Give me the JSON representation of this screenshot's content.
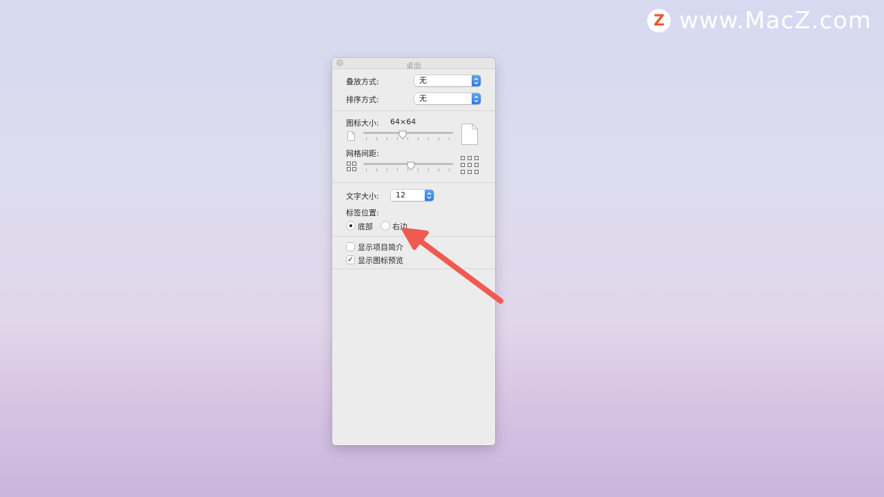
{
  "watermark": {
    "logo_letter": "Z",
    "text": "www.MacZ.com"
  },
  "window": {
    "title": "桌面"
  },
  "stack": {
    "label": "叠放方式:",
    "value": "无"
  },
  "sort": {
    "label": "排序方式:",
    "value": "无"
  },
  "icon_size": {
    "label": "图标大小:",
    "value": "64×64"
  },
  "grid_spacing": {
    "label": "网格间距:"
  },
  "text_size": {
    "label": "文字大小:",
    "value": "12"
  },
  "label_position": {
    "label": "标签位置:",
    "options": [
      "底部",
      "右边"
    ],
    "selected": "底部"
  },
  "options": [
    {
      "label": "显示项目简介",
      "checked": false
    },
    {
      "label": "显示图标预览",
      "checked": true
    }
  ],
  "icon_size_slider": {
    "fraction": 0.44
  },
  "grid_spacing_slider": {
    "fraction": 0.53
  },
  "colors": {
    "accent": "#2f78ea",
    "annotation_arrow": "#ef5a52"
  },
  "icons": {
    "close": "close-button",
    "popup": "chevron-up-down-icon",
    "small_file": "small-document-icon",
    "large_file": "large-document-icon",
    "small_grid": "small-grid-icon",
    "large_grid": "large-grid-icon"
  }
}
